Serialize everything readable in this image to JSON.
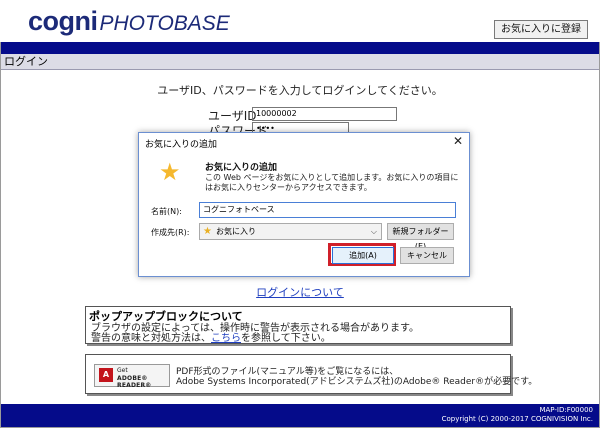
{
  "header": {
    "logo_cogni": "cogni",
    "logo_photobase": "PHOTOBASE",
    "favorite_button": "お気に入りに登録"
  },
  "login": {
    "section_title": "ログイン",
    "instruction": "ユーザID、パスワードを入力してログインしてください。",
    "userid_label": "ユーザID",
    "userid_value": "10000002",
    "password_label": "パスワード",
    "password_value": "••••",
    "about_login_link": "ログインについて"
  },
  "popup_notice": {
    "title": "ポップアップブロックについて",
    "line1": "ブラウザの設定によっては、操作時に警告が表示される場合があります。",
    "line2_before": "警告の意味と対処方法は、",
    "line2_link": "こちら",
    "line2_after": "を参照して下さい。"
  },
  "pdf_notice": {
    "badge_get": "Get",
    "badge_reader": "ADOBE® READER®",
    "line1": "PDF形式のファイル(マニュアル等)をご覧になるには、",
    "line2": "Adobe Systems Incorporated(アドビシステムズ社)のAdobe® Reader®が必要です。"
  },
  "footer": {
    "map_id": "MAP-ID:F00000",
    "copyright": "Copyright (C) 2000-2017 COGNIVISION Inc."
  },
  "dialog": {
    "title": "お気に入りの追加",
    "heading": "お気に入りの追加",
    "description": "この Web ページをお気に入りとして追加します。お気に入りの項目にはお気に入りセンターからアクセスできます。",
    "name_label": "名前(N):",
    "name_value": "コグニフォトベース",
    "location_label": "作成先(R):",
    "location_value": "お気に入り",
    "new_folder_button": "新規フォルダー(E)",
    "add_button": "追加(A)",
    "cancel_button": "キャンセル"
  },
  "colors": {
    "header_bar": "#050b8a",
    "logo": "#1c2a78",
    "link": "#1f3fbf",
    "highlight": "#d0202a"
  }
}
